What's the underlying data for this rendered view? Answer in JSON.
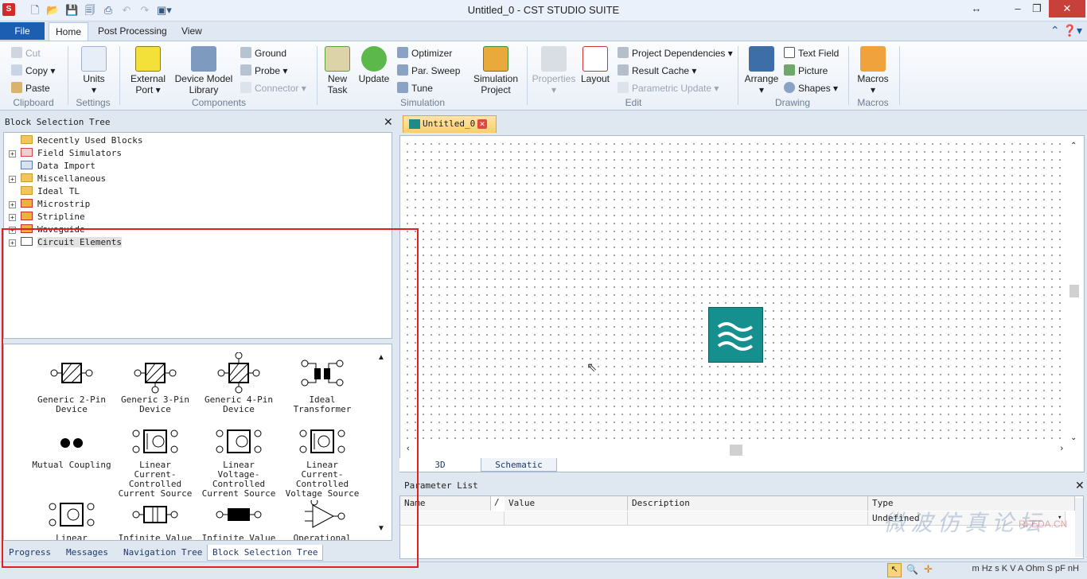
{
  "window": {
    "title": "Untitled_0 - CST STUDIO SUITE",
    "app_icon_text": "S"
  },
  "menu_tabs": {
    "file": "File",
    "home": "Home",
    "post_processing": "Post Processing",
    "view": "View"
  },
  "ribbon": {
    "clipboard": {
      "label": "Clipboard",
      "cut": "Cut",
      "copy": "Copy",
      "paste": "Paste"
    },
    "settings": {
      "label": "Settings",
      "units": "Units"
    },
    "components": {
      "label": "Components",
      "external_port_1": "External",
      "external_port_2": "Port",
      "device_model_1": "Device Model",
      "device_model_2": "Library",
      "ground": "Ground",
      "probe": "Probe",
      "connector": "Connector"
    },
    "simulation": {
      "label": "Simulation",
      "new_task_1": "New",
      "new_task_2": "Task",
      "update": "Update",
      "optimizer": "Optimizer",
      "par_sweep": "Par. Sweep",
      "tune": "Tune",
      "simulation_project_1": "Simulation",
      "simulation_project_2": "Project"
    },
    "edit": {
      "label": "Edit",
      "properties": "Properties",
      "layout": "Layout",
      "project_dependencies": "Project Dependencies",
      "result_cache": "Result Cache",
      "parametric_update": "Parametric Update"
    },
    "drawing": {
      "label": "Drawing",
      "arrange": "Arrange",
      "text_field": "Text Field",
      "picture": "Picture",
      "shapes": "Shapes"
    },
    "macros": {
      "label": "Macros",
      "macros": "Macros"
    }
  },
  "left_panel": {
    "title": "Block Selection Tree",
    "tree": [
      {
        "label": "Recently Used Blocks",
        "expandable": false
      },
      {
        "label": "Field Simulators",
        "expandable": true
      },
      {
        "label": "Data Import",
        "expandable": false
      },
      {
        "label": "Miscellaneous",
        "expandable": true
      },
      {
        "label": "Ideal TL",
        "expandable": false
      },
      {
        "label": "Microstrip",
        "expandable": true
      },
      {
        "label": "Stripline",
        "expandable": true
      },
      {
        "label": "Waveguide",
        "expandable": true
      },
      {
        "label": "Circuit Elements",
        "expandable": true
      }
    ],
    "palette": [
      {
        "l1": "Generic 2-Pin",
        "l2": "Device",
        "l3": ""
      },
      {
        "l1": "Generic 3-Pin",
        "l2": "Device",
        "l3": ""
      },
      {
        "l1": "Generic 4-Pin",
        "l2": "Device",
        "l3": ""
      },
      {
        "l1": "Ideal",
        "l2": "Transformer",
        "l3": ""
      },
      {
        "l1": "Mutual Coupling",
        "l2": "",
        "l3": ""
      },
      {
        "l1": "Linear",
        "l2": "Current-Controlled",
        "l3": "Current Source"
      },
      {
        "l1": "Linear",
        "l2": "Voltage-Controlled",
        "l3": "Current Source"
      },
      {
        "l1": "Linear",
        "l2": "Current-Controlled",
        "l3": "Voltage Source"
      },
      {
        "l1": "Linear",
        "l2": "",
        "l3": ""
      },
      {
        "l1": "Infinite Value",
        "l2": "",
        "l3": ""
      },
      {
        "l1": "Infinite Value",
        "l2": "",
        "l3": ""
      },
      {
        "l1": "Operational",
        "l2": "",
        "l3": ""
      }
    ],
    "bottom_tabs": [
      "Progress",
      "Messages",
      "Navigation Tree",
      "Block Selection Tree"
    ]
  },
  "document": {
    "tab_title": "Untitled_0",
    "view_tabs": [
      "3D",
      "Schematic"
    ]
  },
  "parameter_list": {
    "title": "Parameter List",
    "columns": [
      "Name",
      "/",
      "Value",
      "Description",
      "Type"
    ],
    "row": {
      "type": "Undefined"
    }
  },
  "watermark": {
    "text": "微波仿真论坛",
    "url": "RFEDA.CN"
  },
  "statusbar": {
    "units": "m  Hz  s  K  V  A  Ohm  S  pF  nH"
  },
  "colors": {
    "accent": "#1c5fb2",
    "teal_block": "#168f8f",
    "highlight": "#e02020"
  }
}
